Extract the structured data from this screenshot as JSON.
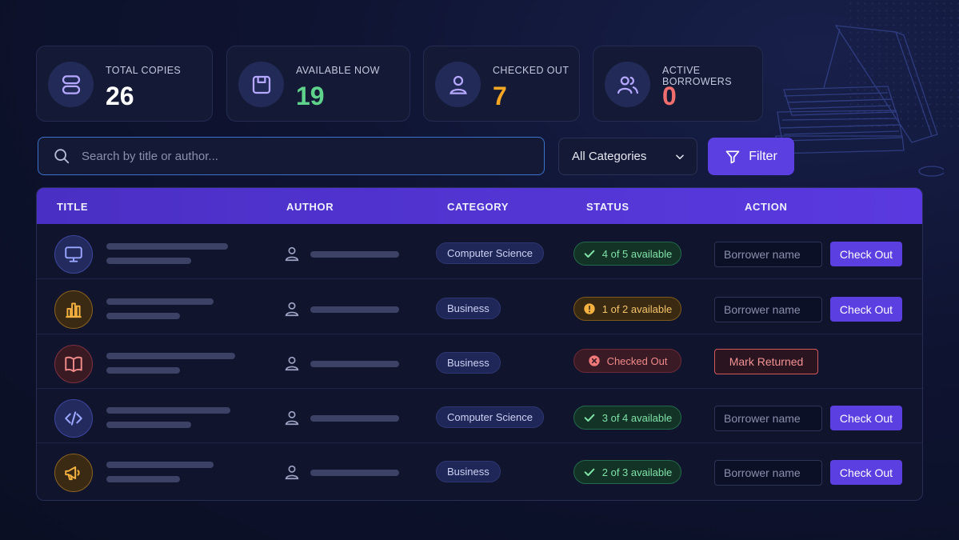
{
  "colors": {
    "accent": "#5b3fe0",
    "ok": "#7fe3a8",
    "warn": "#f5c46a",
    "danger": "#f08a8a",
    "stat_total": "#ffffff",
    "stat_available": "#5fd38b",
    "stat_checked_out": "#f5a623",
    "stat_borrowers": "#f26d6d"
  },
  "stats": [
    {
      "label": "TOTAL COPIES",
      "value": "26",
      "icon": "database-icon"
    },
    {
      "label": "AVAILABLE NOW",
      "value": "19",
      "icon": "save-box-icon"
    },
    {
      "label": "CHECKED OUT",
      "value": "7",
      "icon": "user-icon"
    },
    {
      "label": "ACTIVE BORROWERS",
      "value": "0",
      "icon": "users-icon"
    }
  ],
  "search": {
    "placeholder": "Search by title or author..."
  },
  "category_filter": {
    "selected": "All Categories"
  },
  "filter_button": {
    "label": "Filter"
  },
  "table": {
    "headers": [
      "TITLE",
      "AUTHOR",
      "CATEGORY",
      "STATUS",
      "ACTION"
    ],
    "rows": [
      {
        "icon": "monitor-icon",
        "category": "Computer Science",
        "status": "4 of 5 available",
        "status_kind": "ok",
        "borrower_placeholder": "Borrower name",
        "action": "Check Out"
      },
      {
        "icon": "bar-chart-icon",
        "category": "Business",
        "status": "1 of 2 available",
        "status_kind": "warn",
        "borrower_placeholder": "Borrower name",
        "action": "Check Out"
      },
      {
        "icon": "open-book-icon",
        "category": "Business",
        "status": "Checked Out",
        "status_kind": "out",
        "action": "Mark Returned"
      },
      {
        "icon": "code-icon",
        "category": "Computer Science",
        "status": "3 of 4 available",
        "status_kind": "ok",
        "borrower_placeholder": "Borrower name",
        "action": "Check Out"
      },
      {
        "icon": "megaphone-icon",
        "category": "Business",
        "status": "2 of 3 available",
        "status_kind": "ok",
        "borrower_placeholder": "Borrower name",
        "action": "Check Out"
      }
    ]
  }
}
